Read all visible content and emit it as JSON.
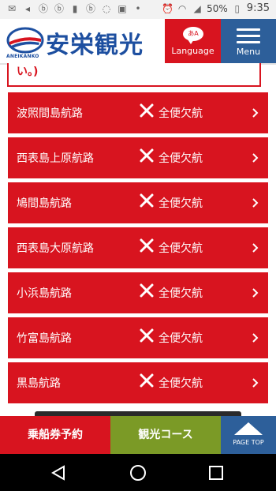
{
  "status_bar": {
    "icons": [
      "mail-icon",
      "send-icon",
      "b-app-icon",
      "b-app-icon",
      "video-icon",
      "b-app-icon",
      "signal-off-icon",
      "image-icon",
      "more-icon",
      "alarm-icon",
      "wifi-icon",
      "cell-signal-icon",
      "battery-icon"
    ],
    "battery": "50%",
    "time": "9:35"
  },
  "header": {
    "logo_text": "安栄観光",
    "logo_sub": "ANEIKANKO",
    "language_bubble": "あA",
    "language_label": "Language",
    "menu_label": "Menu"
  },
  "notice": {
    "text": "い。)"
  },
  "routes": [
    {
      "name": "波照間島航路",
      "status": "全便欠航"
    },
    {
      "name": "西表島上原航路",
      "status": "全便欠航"
    },
    {
      "name": "鳩間島航路",
      "status": "全便欠航"
    },
    {
      "name": "西表島大原航路",
      "status": "全便欠航"
    },
    {
      "name": "小浜島航路",
      "status": "全便欠航"
    },
    {
      "name": "竹富島航路",
      "status": "全便欠航"
    },
    {
      "name": "黒島航路",
      "status": "全便欠航"
    }
  ],
  "bottom": {
    "ticket": "乗船券予約",
    "tour": "観光コース",
    "page_top": "PAGE TOP"
  },
  "colors": {
    "red": "#d8141f",
    "blue": "#2d5f9a",
    "green": "#7b9a26",
    "logo_blue": "#1d4fa0"
  }
}
